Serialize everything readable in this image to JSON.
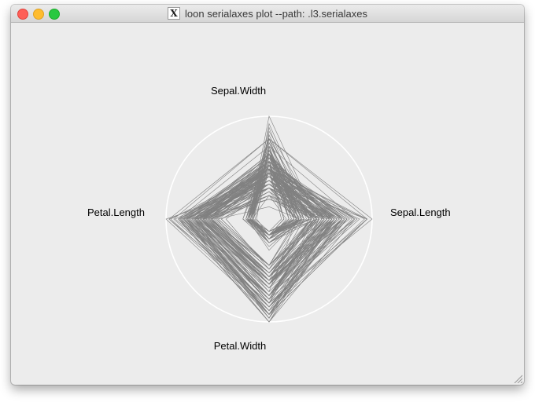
{
  "window": {
    "title": "loon serialaxes plot --path: .l3.serialaxes",
    "app_icon": "x11-icon"
  },
  "chart_data": {
    "type": "radar",
    "axes": [
      "Sepal.Length",
      "Sepal.Width",
      "Petal.Length",
      "Petal.Width"
    ],
    "scaling": "variable",
    "line_color": "#808080",
    "enclosing_circle_color": "#ffffff",
    "background_color": "#ececec",
    "series_count": 150,
    "series": [
      [
        5.1,
        3.5,
        1.4,
        0.2
      ],
      [
        4.9,
        3.0,
        1.4,
        0.2
      ],
      [
        4.7,
        3.2,
        1.3,
        0.2
      ],
      [
        4.6,
        3.1,
        1.5,
        0.2
      ],
      [
        5.0,
        3.6,
        1.4,
        0.2
      ],
      [
        5.4,
        3.9,
        1.7,
        0.4
      ],
      [
        4.6,
        3.4,
        1.4,
        0.3
      ],
      [
        5.0,
        3.4,
        1.5,
        0.2
      ],
      [
        4.4,
        2.9,
        1.4,
        0.2
      ],
      [
        4.9,
        3.1,
        1.5,
        0.1
      ],
      [
        5.4,
        3.7,
        1.5,
        0.2
      ],
      [
        4.8,
        3.4,
        1.6,
        0.2
      ],
      [
        4.8,
        3.0,
        1.4,
        0.1
      ],
      [
        4.3,
        3.0,
        1.1,
        0.1
      ],
      [
        5.8,
        4.0,
        1.2,
        0.2
      ],
      [
        5.7,
        4.4,
        1.5,
        0.4
      ],
      [
        5.4,
        3.9,
        1.3,
        0.4
      ],
      [
        5.1,
        3.5,
        1.4,
        0.3
      ],
      [
        5.7,
        3.8,
        1.7,
        0.3
      ],
      [
        5.1,
        3.8,
        1.5,
        0.3
      ],
      [
        5.4,
        3.4,
        1.7,
        0.2
      ],
      [
        5.1,
        3.7,
        1.5,
        0.4
      ],
      [
        4.6,
        3.6,
        1.0,
        0.2
      ],
      [
        5.1,
        3.3,
        1.7,
        0.5
      ],
      [
        4.8,
        3.4,
        1.9,
        0.2
      ],
      [
        5.0,
        3.0,
        1.6,
        0.2
      ],
      [
        5.0,
        3.4,
        1.6,
        0.4
      ],
      [
        5.2,
        3.5,
        1.5,
        0.2
      ],
      [
        5.2,
        3.4,
        1.4,
        0.2
      ],
      [
        4.7,
        3.2,
        1.6,
        0.2
      ],
      [
        4.8,
        3.1,
        1.6,
        0.2
      ],
      [
        5.4,
        3.4,
        1.5,
        0.4
      ],
      [
        5.2,
        4.1,
        1.5,
        0.1
      ],
      [
        5.5,
        4.2,
        1.4,
        0.2
      ],
      [
        4.9,
        3.1,
        1.5,
        0.2
      ],
      [
        5.0,
        3.2,
        1.2,
        0.2
      ],
      [
        5.5,
        3.5,
        1.3,
        0.2
      ],
      [
        4.9,
        3.6,
        1.4,
        0.1
      ],
      [
        4.4,
        3.0,
        1.3,
        0.2
      ],
      [
        5.1,
        3.4,
        1.5,
        0.2
      ],
      [
        5.0,
        3.5,
        1.3,
        0.3
      ],
      [
        4.5,
        2.3,
        1.3,
        0.3
      ],
      [
        4.4,
        3.2,
        1.3,
        0.2
      ],
      [
        5.0,
        3.5,
        1.6,
        0.6
      ],
      [
        5.1,
        3.8,
        1.9,
        0.4
      ],
      [
        4.8,
        3.0,
        1.4,
        0.3
      ],
      [
        5.1,
        3.8,
        1.6,
        0.2
      ],
      [
        4.6,
        3.2,
        1.4,
        0.2
      ],
      [
        5.3,
        3.7,
        1.5,
        0.2
      ],
      [
        5.0,
        3.3,
        1.4,
        0.2
      ],
      [
        7.0,
        3.2,
        4.7,
        1.4
      ],
      [
        6.4,
        3.2,
        4.5,
        1.5
      ],
      [
        6.9,
        3.1,
        4.9,
        1.5
      ],
      [
        5.5,
        2.3,
        4.0,
        1.3
      ],
      [
        6.5,
        2.8,
        4.6,
        1.5
      ],
      [
        5.7,
        2.8,
        4.5,
        1.3
      ],
      [
        6.3,
        3.3,
        4.7,
        1.6
      ],
      [
        4.9,
        2.4,
        3.3,
        1.0
      ],
      [
        6.6,
        2.9,
        4.6,
        1.3
      ],
      [
        5.2,
        2.7,
        3.9,
        1.4
      ],
      [
        5.0,
        2.0,
        3.5,
        1.0
      ],
      [
        5.9,
        3.0,
        4.2,
        1.5
      ],
      [
        6.0,
        2.2,
        4.0,
        1.0
      ],
      [
        6.1,
        2.9,
        4.7,
        1.4
      ],
      [
        5.6,
        2.9,
        3.6,
        1.3
      ],
      [
        6.7,
        3.1,
        4.4,
        1.4
      ],
      [
        5.6,
        3.0,
        4.5,
        1.5
      ],
      [
        5.8,
        2.7,
        4.1,
        1.0
      ],
      [
        6.2,
        2.2,
        4.5,
        1.5
      ],
      [
        5.6,
        2.5,
        3.9,
        1.1
      ],
      [
        5.9,
        3.2,
        4.8,
        1.8
      ],
      [
        6.1,
        2.8,
        4.0,
        1.3
      ],
      [
        6.3,
        2.5,
        4.9,
        1.5
      ],
      [
        6.1,
        2.8,
        4.7,
        1.2
      ],
      [
        6.4,
        2.9,
        4.3,
        1.3
      ],
      [
        6.6,
        3.0,
        4.4,
        1.4
      ],
      [
        6.8,
        2.8,
        4.8,
        1.4
      ],
      [
        6.7,
        3.0,
        5.0,
        1.7
      ],
      [
        6.0,
        2.9,
        4.5,
        1.5
      ],
      [
        5.7,
        2.6,
        3.5,
        1.0
      ],
      [
        5.5,
        2.4,
        3.8,
        1.1
      ],
      [
        5.5,
        2.4,
        3.7,
        1.0
      ],
      [
        5.8,
        2.7,
        3.9,
        1.2
      ],
      [
        6.0,
        2.7,
        5.1,
        1.6
      ],
      [
        5.4,
        3.0,
        4.5,
        1.5
      ],
      [
        6.0,
        3.4,
        4.5,
        1.6
      ],
      [
        6.7,
        3.1,
        4.7,
        1.5
      ],
      [
        6.3,
        2.3,
        4.4,
        1.3
      ],
      [
        5.6,
        3.0,
        4.1,
        1.3
      ],
      [
        5.5,
        2.5,
        4.0,
        1.3
      ],
      [
        5.5,
        2.6,
        4.4,
        1.2
      ],
      [
        6.1,
        3.0,
        4.6,
        1.4
      ],
      [
        5.8,
        2.6,
        4.0,
        1.2
      ],
      [
        5.0,
        2.3,
        3.3,
        1.0
      ],
      [
        5.6,
        2.7,
        4.2,
        1.3
      ],
      [
        5.7,
        3.0,
        4.2,
        1.2
      ],
      [
        5.7,
        2.9,
        4.2,
        1.3
      ],
      [
        6.2,
        2.9,
        4.3,
        1.3
      ],
      [
        5.1,
        2.5,
        3.0,
        1.1
      ],
      [
        5.7,
        2.8,
        4.1,
        1.3
      ],
      [
        6.3,
        3.3,
        6.0,
        2.5
      ],
      [
        5.8,
        2.7,
        5.1,
        1.9
      ],
      [
        7.1,
        3.0,
        5.9,
        2.1
      ],
      [
        6.3,
        2.9,
        5.6,
        1.8
      ],
      [
        6.5,
        3.0,
        5.8,
        2.2
      ],
      [
        7.6,
        3.0,
        6.6,
        2.1
      ],
      [
        4.9,
        2.5,
        4.5,
        1.7
      ],
      [
        7.3,
        2.9,
        6.3,
        1.8
      ],
      [
        6.7,
        2.5,
        5.8,
        1.8
      ],
      [
        7.2,
        3.6,
        6.1,
        2.5
      ],
      [
        6.5,
        3.2,
        5.1,
        2.0
      ],
      [
        6.4,
        2.7,
        5.3,
        1.9
      ],
      [
        6.8,
        3.0,
        5.5,
        2.1
      ],
      [
        5.7,
        2.5,
        5.0,
        2.0
      ],
      [
        5.8,
        2.8,
        5.1,
        2.4
      ],
      [
        6.4,
        3.2,
        5.3,
        2.3
      ],
      [
        6.5,
        3.0,
        5.5,
        1.8
      ],
      [
        7.7,
        3.8,
        6.7,
        2.2
      ],
      [
        7.7,
        2.6,
        6.9,
        2.3
      ],
      [
        6.0,
        2.2,
        5.0,
        1.5
      ],
      [
        6.9,
        3.2,
        5.7,
        2.3
      ],
      [
        5.6,
        2.8,
        4.9,
        2.0
      ],
      [
        7.7,
        2.8,
        6.7,
        2.0
      ],
      [
        6.3,
        2.7,
        4.9,
        1.8
      ],
      [
        6.7,
        3.3,
        5.7,
        2.1
      ],
      [
        7.2,
        3.2,
        6.0,
        1.8
      ],
      [
        6.2,
        2.8,
        4.8,
        1.8
      ],
      [
        6.1,
        3.0,
        4.9,
        1.8
      ],
      [
        6.4,
        2.8,
        5.6,
        2.1
      ],
      [
        7.2,
        3.0,
        5.8,
        1.6
      ],
      [
        7.4,
        2.8,
        6.1,
        1.9
      ],
      [
        7.9,
        3.8,
        6.4,
        2.0
      ],
      [
        6.4,
        2.8,
        5.6,
        2.2
      ],
      [
        6.3,
        2.8,
        5.1,
        1.5
      ],
      [
        6.1,
        2.6,
        5.6,
        1.4
      ],
      [
        7.7,
        3.0,
        6.1,
        2.3
      ],
      [
        6.3,
        3.4,
        5.6,
        2.4
      ],
      [
        6.4,
        3.1,
        5.5,
        1.8
      ],
      [
        6.0,
        3.0,
        4.8,
        1.8
      ],
      [
        6.9,
        3.1,
        5.4,
        2.1
      ],
      [
        6.7,
        3.1,
        5.6,
        2.4
      ],
      [
        6.9,
        3.1,
        5.1,
        2.3
      ],
      [
        5.8,
        2.7,
        5.1,
        1.9
      ],
      [
        6.8,
        3.2,
        5.9,
        2.3
      ],
      [
        6.7,
        3.3,
        5.7,
        2.5
      ],
      [
        6.7,
        3.0,
        5.2,
        2.3
      ],
      [
        6.3,
        2.5,
        5.0,
        1.9
      ],
      [
        6.5,
        3.0,
        5.2,
        2.0
      ],
      [
        6.2,
        3.4,
        5.4,
        2.3
      ],
      [
        5.9,
        3.0,
        5.1,
        1.8
      ]
    ]
  }
}
